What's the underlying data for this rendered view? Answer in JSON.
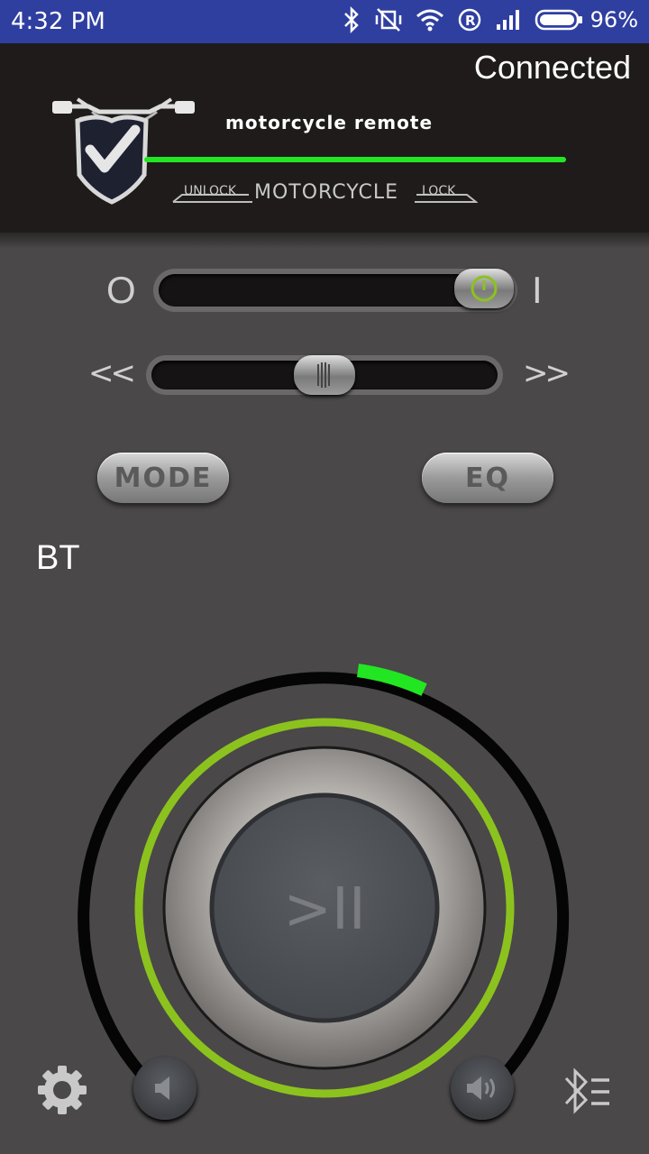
{
  "status_bar": {
    "time": "4:32 PM",
    "battery": "96%",
    "icons": [
      "bluetooth-icon",
      "vibrate-off-icon",
      "wifi-icon",
      "roaming-icon",
      "signal-icon",
      "battery-icon"
    ]
  },
  "header": {
    "connection_status": "Connected",
    "app_title": "motorcycle  remote",
    "lock_bar": {
      "unlock_label": "UNLOCK",
      "motorcycle_label": "MOTORCYCLE",
      "lock_label": "LOCK"
    },
    "accent_color": "#22e622"
  },
  "power_slider": {
    "off_label": "O",
    "on_label": "I",
    "value": 1
  },
  "seek_slider": {
    "prev_label": "<<",
    "next_label": ">>",
    "value": 0.5
  },
  "buttons": {
    "mode_label": "MODE",
    "eq_label": "EQ"
  },
  "source_label": "BT",
  "dial": {
    "play_pause_label": ">II",
    "volume_level": 0.12,
    "ring_color": "#8cc21e"
  },
  "bottom_bar": {
    "icons": [
      "gear-icon",
      "volume-down-icon",
      "volume-up-icon",
      "bluetooth-menu-icon"
    ]
  }
}
